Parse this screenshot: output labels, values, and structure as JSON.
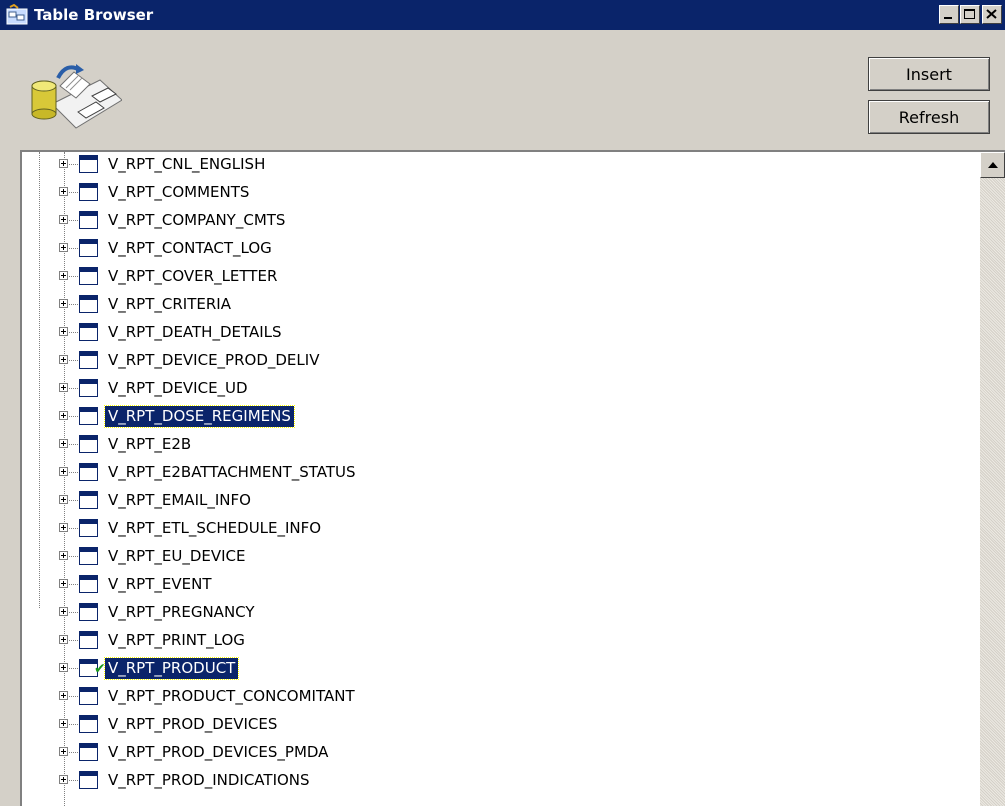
{
  "window": {
    "title": "Table Browser",
    "icon": "table-browser-app-icon"
  },
  "titlebar_buttons": {
    "minimize_icon": "minimize-icon",
    "maximize_icon": "maximize-icon",
    "close_icon": "close-icon"
  },
  "toolbar": {
    "insert_label": "Insert",
    "refresh_label": "Refresh"
  },
  "tree": {
    "items": [
      {
        "label": "V_RPT_CNL_ENGLISH",
        "selected": false,
        "checked": false
      },
      {
        "label": "V_RPT_COMMENTS",
        "selected": false,
        "checked": false
      },
      {
        "label": "V_RPT_COMPANY_CMTS",
        "selected": false,
        "checked": false
      },
      {
        "label": "V_RPT_CONTACT_LOG",
        "selected": false,
        "checked": false
      },
      {
        "label": "V_RPT_COVER_LETTER",
        "selected": false,
        "checked": false
      },
      {
        "label": "V_RPT_CRITERIA",
        "selected": false,
        "checked": false
      },
      {
        "label": "V_RPT_DEATH_DETAILS",
        "selected": false,
        "checked": false
      },
      {
        "label": "V_RPT_DEVICE_PROD_DELIV",
        "selected": false,
        "checked": false
      },
      {
        "label": "V_RPT_DEVICE_UD",
        "selected": false,
        "checked": false
      },
      {
        "label": "V_RPT_DOSE_REGIMENS",
        "selected": true,
        "checked": false
      },
      {
        "label": "V_RPT_E2B",
        "selected": false,
        "checked": false
      },
      {
        "label": "V_RPT_E2BATTACHMENT_STATUS",
        "selected": false,
        "checked": false
      },
      {
        "label": "V_RPT_EMAIL_INFO",
        "selected": false,
        "checked": false
      },
      {
        "label": "V_RPT_ETL_SCHEDULE_INFO",
        "selected": false,
        "checked": false
      },
      {
        "label": "V_RPT_EU_DEVICE",
        "selected": false,
        "checked": false
      },
      {
        "label": "V_RPT_EVENT",
        "selected": false,
        "checked": false
      },
      {
        "label": "V_RPT_PREGNANCY",
        "selected": false,
        "checked": false
      },
      {
        "label": "V_RPT_PRINT_LOG",
        "selected": false,
        "checked": false
      },
      {
        "label": "V_RPT_PRODUCT",
        "selected": true,
        "checked": true
      },
      {
        "label": "V_RPT_PRODUCT_CONCOMITANT",
        "selected": false,
        "checked": false
      },
      {
        "label": "V_RPT_PROD_DEVICES",
        "selected": false,
        "checked": false
      },
      {
        "label": "V_RPT_PROD_DEVICES_PMDA",
        "selected": false,
        "checked": false
      },
      {
        "label": "V_RPT_PROD_INDICATIONS",
        "selected": false,
        "checked": false
      }
    ]
  },
  "colors": {
    "titlebar": "#0a246a",
    "selection": "#0a246a",
    "face": "#d4d0c8",
    "check": "#1a9a1a"
  }
}
